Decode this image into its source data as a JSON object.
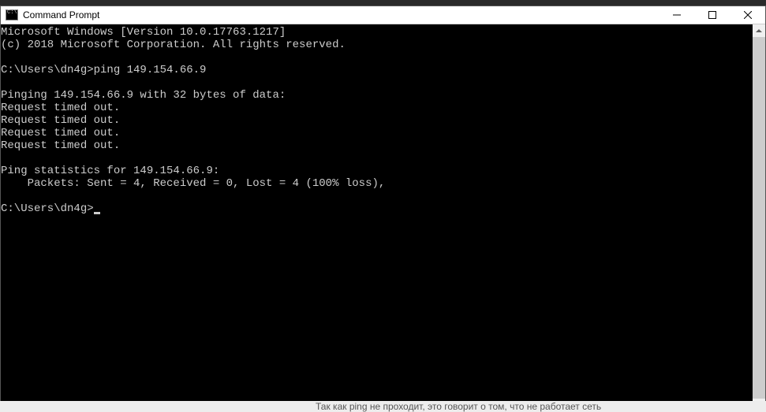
{
  "window": {
    "title": "Command Prompt"
  },
  "terminal": {
    "lines": [
      "Microsoft Windows [Version 10.0.17763.1217]",
      "(c) 2018 Microsoft Corporation. All rights reserved.",
      "",
      "C:\\Users\\dn4g>ping 149.154.66.9",
      "",
      "Pinging 149.154.66.9 with 32 bytes of data:",
      "Request timed out.",
      "Request timed out.",
      "Request timed out.",
      "Request timed out.",
      "",
      "Ping statistics for 149.154.66.9:",
      "    Packets: Sent = 4, Received = 0, Lost = 4 (100% loss),",
      ""
    ],
    "prompt": "C:\\Users\\dn4g>"
  },
  "bottom_text": "Так как ping не проходит, это говорит о том, что не работает сеть"
}
